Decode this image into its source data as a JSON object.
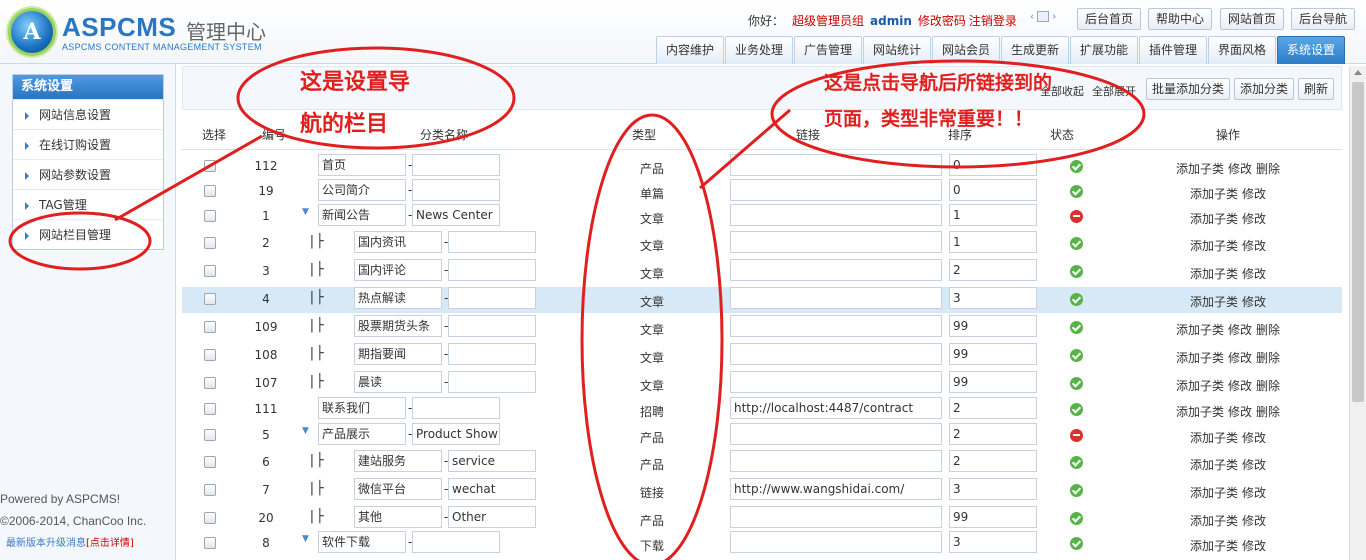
{
  "header": {
    "logo_letter": "A",
    "logo_title": "ASPCMS",
    "logo_subtitle": "管理中心",
    "logo_english": "ASPCMS CONTENT MANAGEMENT SYSTEM",
    "greeting": "你好：",
    "user_group": "超级管理员组",
    "username": "admin",
    "change_password": "修改密码",
    "logout": "注销登录",
    "top_buttons": [
      "后台首页",
      "帮助中心",
      "网站首页",
      "后台导航"
    ],
    "tabs": [
      "内容维护",
      "业务处理",
      "广告管理",
      "网站统计",
      "网站会员",
      "生成更新",
      "扩展功能",
      "插件管理",
      "界面风格",
      "系统设置"
    ],
    "active_tab": "系统设置"
  },
  "sidebar": {
    "title": "系统设置",
    "items": [
      "网站信息设置",
      "在线订购设置",
      "网站参数设置",
      "TAG管理",
      "网站栏目管理"
    ],
    "powered": "Powered by ASPCMS!",
    "copyright": "©2006-2014, ChanCoo Inc.",
    "upgrade_text": "最新版本升级消息",
    "upgrade_link": "[点击详情]"
  },
  "toolbar": {
    "collapse_all": "全部收起",
    "expand_all": "全部展开",
    "batch_add": "批量添加分类",
    "add": "添加分类",
    "refresh": "刷新"
  },
  "table": {
    "headers": [
      "选择",
      "编号",
      "分类名称",
      "类型",
      "链接",
      "排序",
      "状态",
      "操作"
    ],
    "rows": [
      {
        "id": "112",
        "name": "首页",
        "en": "",
        "type": "产品",
        "link": "",
        "order": "0",
        "status": "ok",
        "ops": [
          "添加子类",
          "修改",
          "删除"
        ],
        "level": 0,
        "expand": false
      },
      {
        "id": "19",
        "name": "公司简介",
        "en": "",
        "type": "单篇",
        "link": "",
        "order": "0",
        "status": "ok",
        "ops": [
          "添加子类",
          "修改"
        ],
        "level": 0,
        "expand": false
      },
      {
        "id": "1",
        "name": "新闻公告",
        "en": "News Center",
        "type": "文章",
        "link": "",
        "order": "1",
        "status": "no",
        "ops": [
          "添加子类",
          "修改"
        ],
        "level": 0,
        "expand": true
      },
      {
        "id": "2",
        "name": "国内资讯",
        "en": "",
        "type": "文章",
        "link": "",
        "order": "1",
        "status": "ok",
        "ops": [
          "添加子类",
          "修改"
        ],
        "level": 1,
        "expand": false
      },
      {
        "id": "3",
        "name": "国内评论",
        "en": "",
        "type": "文章",
        "link": "",
        "order": "2",
        "status": "ok",
        "ops": [
          "添加子类",
          "修改"
        ],
        "level": 1,
        "expand": false
      },
      {
        "id": "4",
        "name": "热点解读",
        "en": "",
        "type": "文章",
        "link": "",
        "order": "3",
        "status": "ok",
        "ops": [
          "添加子类",
          "修改"
        ],
        "level": 1,
        "expand": false,
        "highlight": true
      },
      {
        "id": "109",
        "name": "股票期货头条",
        "en": "",
        "type": "文章",
        "link": "",
        "order": "99",
        "status": "ok",
        "ops": [
          "添加子类",
          "修改",
          "删除"
        ],
        "level": 1,
        "expand": false
      },
      {
        "id": "108",
        "name": "期指要闻",
        "en": "",
        "type": "文章",
        "link": "",
        "order": "99",
        "status": "ok",
        "ops": [
          "添加子类",
          "修改",
          "删除"
        ],
        "level": 1,
        "expand": false
      },
      {
        "id": "107",
        "name": "晨读",
        "en": "",
        "type": "文章",
        "link": "",
        "order": "99",
        "status": "ok",
        "ops": [
          "添加子类",
          "修改",
          "删除"
        ],
        "level": 1,
        "expand": false
      },
      {
        "id": "111",
        "name": "联系我们",
        "en": "",
        "type": "招聘",
        "link": "http://localhost:4487/contract",
        "order": "2",
        "status": "ok",
        "ops": [
          "添加子类",
          "修改",
          "删除"
        ],
        "level": 0,
        "expand": false
      },
      {
        "id": "5",
        "name": "产品展示",
        "en": "Product Show",
        "type": "产品",
        "link": "",
        "order": "2",
        "status": "no",
        "ops": [
          "添加子类",
          "修改"
        ],
        "level": 0,
        "expand": true
      },
      {
        "id": "6",
        "name": "建站服务",
        "en": "service",
        "type": "产品",
        "link": "",
        "order": "2",
        "status": "ok",
        "ops": [
          "添加子类",
          "修改"
        ],
        "level": 1,
        "expand": false
      },
      {
        "id": "7",
        "name": "微信平台",
        "en": "wechat",
        "type": "链接",
        "link": "http://www.wangshidai.com/",
        "order": "3",
        "status": "ok",
        "ops": [
          "添加子类",
          "修改"
        ],
        "level": 1,
        "expand": false
      },
      {
        "id": "20",
        "name": "其他",
        "en": "Other",
        "type": "产品",
        "link": "",
        "order": "99",
        "status": "ok",
        "ops": [
          "添加子类",
          "修改"
        ],
        "level": 1,
        "expand": false
      },
      {
        "id": "8",
        "name": "软件下载",
        "en": "",
        "type": "下载",
        "link": "",
        "order": "3",
        "status": "ok",
        "ops": [
          "添加子类",
          "修改"
        ],
        "level": 0,
        "expand": true
      }
    ]
  },
  "annotations": {
    "nav_note_line1": "这是设置导",
    "nav_note_line2": "航的栏目",
    "page_note_line1": "这是点击导航后所链接到的",
    "page_note_line2": "页面，类型非常重要！！"
  },
  "colors": {
    "accent": "#2a75c4",
    "annotation": "#e01f1f",
    "highlight_row": "#d7e8f7",
    "status_ok": "#56b447",
    "status_no": "#d9322c"
  }
}
